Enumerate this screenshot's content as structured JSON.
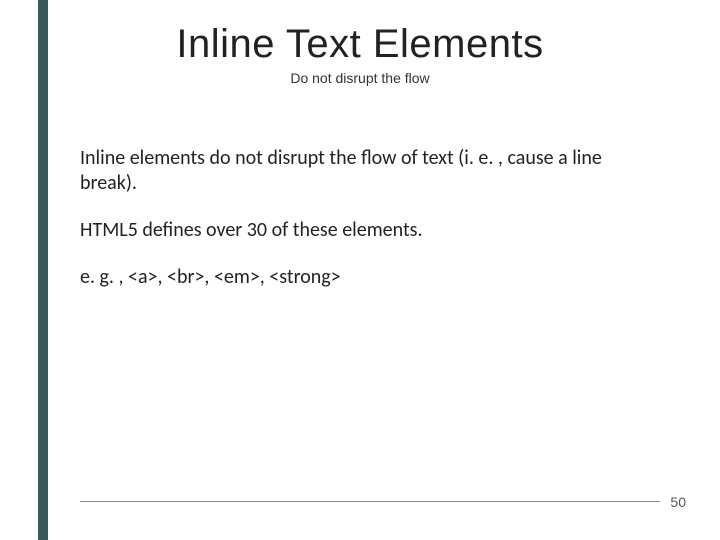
{
  "slide": {
    "title": "Inline Text Elements",
    "subtitle": "Do not disrupt the flow",
    "paragraphs": [
      "Inline elements do not disrupt the flow of text (i. e. , cause a line break).",
      "HTML5 defines over 30 of these elements.",
      "e. g. , <a>, <br>, <em>, <strong>"
    ],
    "page_number": "50"
  }
}
